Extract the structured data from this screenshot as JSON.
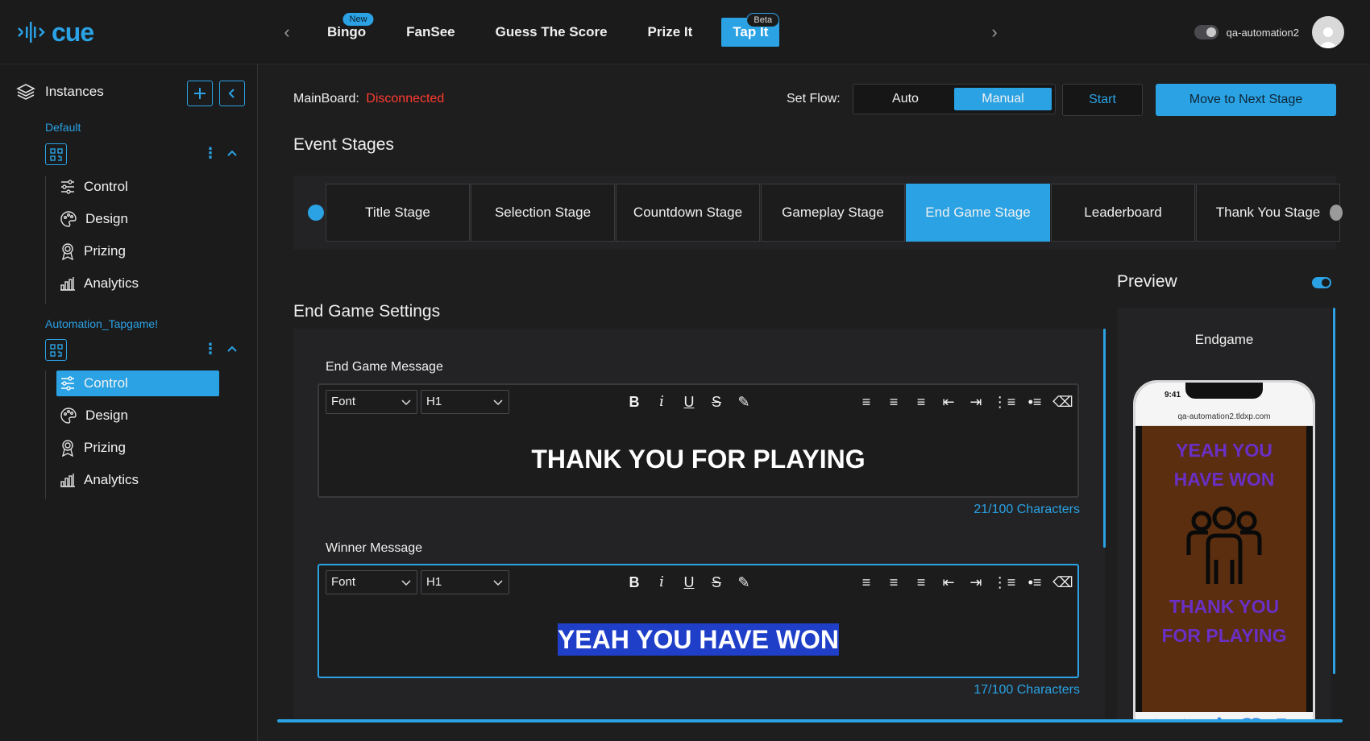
{
  "brand": {
    "logo_text": "cue",
    "accent": "#2aa2e4"
  },
  "topnav": {
    "tabs": [
      {
        "label": "Bingo",
        "badge": "New"
      },
      {
        "label": "FanSee",
        "badge": ""
      },
      {
        "label": "Guess The Score",
        "badge": ""
      },
      {
        "label": "Prize It",
        "badge": ""
      },
      {
        "label": "Tap It",
        "badge": "Beta",
        "active": true
      }
    ],
    "username": "qa-automation2"
  },
  "sidebar": {
    "title": "Instances",
    "groups": [
      {
        "title": "Default",
        "items": [
          {
            "label": "Control",
            "icon": "sliders-icon"
          },
          {
            "label": "Design",
            "icon": "palette-icon"
          },
          {
            "label": "Prizing",
            "icon": "award-icon"
          },
          {
            "label": "Analytics",
            "icon": "bar-chart-icon"
          }
        ]
      },
      {
        "title": "Automation_Tapgame!",
        "items": [
          {
            "label": "Control",
            "icon": "sliders-icon",
            "active": true
          },
          {
            "label": "Design",
            "icon": "palette-icon"
          },
          {
            "label": "Prizing",
            "icon": "award-icon"
          },
          {
            "label": "Analytics",
            "icon": "bar-chart-icon"
          }
        ]
      }
    ]
  },
  "header": {
    "mainboard_label": "MainBoard:",
    "mainboard_status": "Disconnected",
    "setflow_label": "Set Flow:",
    "flow_options": [
      "Auto",
      "Manual"
    ],
    "flow_selected": "Manual",
    "start_label": "Start",
    "next_label": "Move to Next Stage"
  },
  "stages": {
    "title": "Event Stages",
    "items": [
      "Title Stage",
      "Selection Stage",
      "Countdown Stage",
      "Gameplay Stage",
      "End Game Stage",
      "Leaderboard",
      "Thank You Stage"
    ],
    "active": "End Game Stage"
  },
  "settings": {
    "title": "End Game Settings",
    "fields": [
      {
        "label": "End Game Message",
        "font": "Font",
        "heading": "H1",
        "content": "THANK YOU FOR PLAYING",
        "count": "21/100 Characters"
      },
      {
        "label": "Winner Message",
        "font": "Font",
        "heading": "H1",
        "content": "YEAH YOU HAVE WON",
        "count": "17/100 Characters"
      }
    ]
  },
  "preview": {
    "title": "Preview",
    "enabled": true,
    "stage_name": "Endgame",
    "phone_time": "9:41",
    "phone_url": "qa-automation2.tldxp.com",
    "screen_top_lines": [
      "YEAH YOU",
      "HAVE WON"
    ],
    "screen_bottom_lines": [
      "THANK YOU",
      "FOR PLAYING"
    ],
    "screen_bg": "#5a2e0e",
    "screen_text_color": "#6a2fc4"
  }
}
